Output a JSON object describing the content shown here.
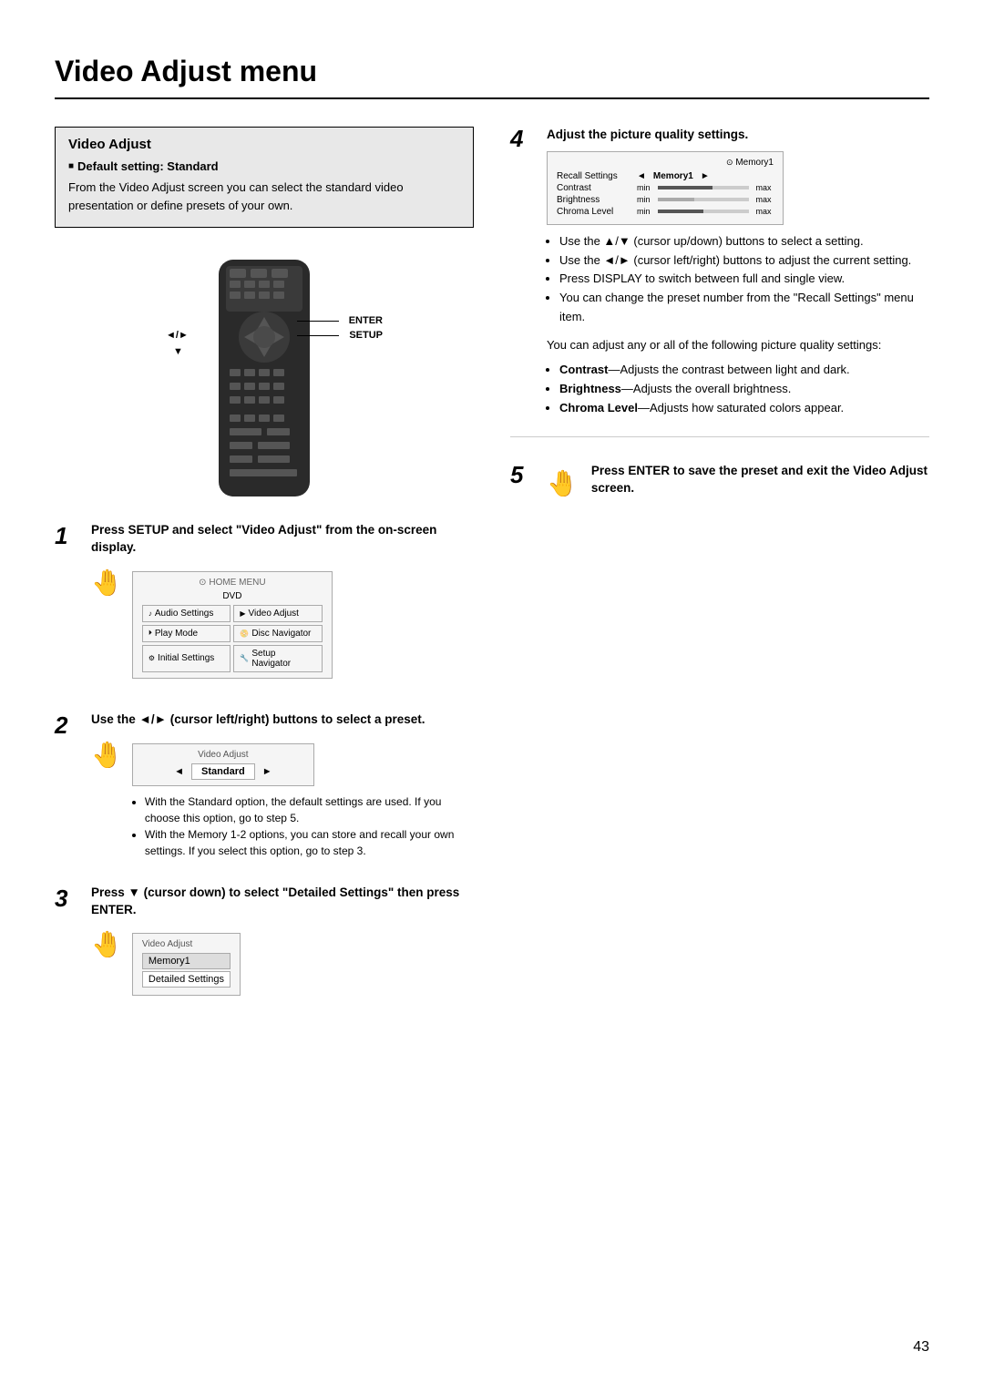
{
  "page": {
    "title": "Video Adjust menu",
    "number": "43"
  },
  "left": {
    "section_title": "Video Adjust",
    "default_label": "Default setting: Standard",
    "intro_text": "From the Video Adjust screen you can select the standard video presentation or define presets of your own.",
    "enter_label": "ENTER",
    "setup_label": "SETUP",
    "steps": [
      {
        "number": "1",
        "header": "Press SETUP and select \"Video Adjust\" from the on-screen display.",
        "screen": {
          "title": "HOME MENU",
          "subtitle": "DVD",
          "items": [
            {
              "icon": "♪",
              "label": "Audio Settings"
            },
            {
              "icon": "▶",
              "label": "Video Adjust"
            },
            {
              "icon": "⏵",
              "label": "Play Mode"
            },
            {
              "icon": "📀",
              "label": "Disc Navigator"
            },
            {
              "icon": "⚙",
              "label": "Initial Settings"
            },
            {
              "icon": "🔧",
              "label": "Setup Navigator"
            }
          ]
        }
      },
      {
        "number": "2",
        "header": "Use the ◄/► (cursor left/right) buttons to select a preset.",
        "screen": {
          "title": "Video Adjust",
          "preset": "Standard"
        },
        "bullets": [
          "With the Standard option, the default settings are used. If you choose this option, go to step 5.",
          "With the Memory 1-2 options, you can store and recall your own settings. If you select this option, go to step 3."
        ]
      },
      {
        "number": "3",
        "header": "Press ▼ (cursor down) to select \"Detailed Settings\" then press ENTER.",
        "screen": {
          "title": "Video Adjust",
          "item1": "Memory1",
          "item2": "Detailed Settings"
        }
      }
    ]
  },
  "right": {
    "steps": [
      {
        "number": "4",
        "header": "Adjust the picture quality settings.",
        "screen": {
          "memory_label": "Memory1",
          "recall_label": "Recall Settings",
          "recall_value": "Memory1",
          "rows": [
            {
              "label": "Contrast",
              "min": "min",
              "fill": 60,
              "max": "max"
            },
            {
              "label": "Brightness",
              "min": "min",
              "fill": 40,
              "max": "max"
            },
            {
              "label": "Chroma Level",
              "min": "min",
              "fill": 50,
              "max": "max"
            }
          ]
        },
        "bullets": [
          {
            "text": "Use the ▲/▼ (cursor up/down) buttons to select a setting."
          },
          {
            "text": "Use the ◄/► (cursor left/right) buttons to adjust the current setting."
          },
          {
            "text": "Press DISPLAY to switch between full and single view."
          },
          {
            "text": "You can change the preset number from the \"Recall Settings\" menu item."
          }
        ],
        "intro": "You can adjust any or all of the following picture quality settings:",
        "quality_settings": [
          {
            "bold": "Contrast",
            "rest": "—Adjusts the contrast between light and dark."
          },
          {
            "bold": "Brightness",
            "rest": "—Adjusts the overall brightness."
          },
          {
            "bold": "Chroma Level",
            "rest": "—Adjusts how saturated colors appear."
          }
        ]
      },
      {
        "number": "5",
        "header": "Press ENTER to save the preset and exit the Video Adjust screen."
      }
    ]
  }
}
